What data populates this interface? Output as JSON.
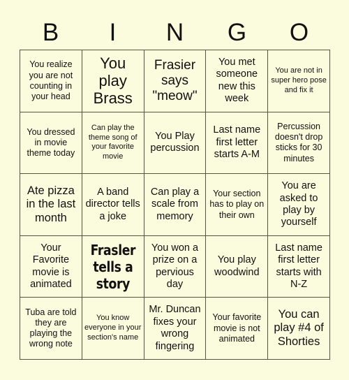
{
  "card": {
    "header_letters": [
      "B",
      "I",
      "N",
      "G",
      "O"
    ],
    "colors": {
      "background": "#FBFBDD",
      "border": "#55553f",
      "text": "#111111"
    },
    "grid_size": "5x5",
    "cells": [
      {
        "text": "You realize you are not counting in your head",
        "size": "s",
        "free": false
      },
      {
        "text": "You play Brass",
        "size": "xxl",
        "free": false
      },
      {
        "text": "Frasier says \"meow\"",
        "size": "xl",
        "free": false
      },
      {
        "text": "You met someone new this week",
        "size": "m",
        "free": false
      },
      {
        "text": "You are not in super hero pose and fix it",
        "size": "xs",
        "free": false
      },
      {
        "text": "You dressed in movie theme today",
        "size": "s",
        "free": false
      },
      {
        "text": "Can play the theme song of your favorite movie",
        "size": "xs",
        "free": false
      },
      {
        "text": "You Play percussion",
        "size": "m",
        "free": false
      },
      {
        "text": "Last name first letter starts A-M",
        "size": "m",
        "free": false
      },
      {
        "text": "Percussion doesn't drop sticks for 30 minutes",
        "size": "s",
        "free": false
      },
      {
        "text": "Ate pizza in the last month",
        "size": "l",
        "free": false
      },
      {
        "text": "A band director tells a joke",
        "size": "m",
        "free": false
      },
      {
        "text": "Can play a scale from memory",
        "size": "m",
        "free": false
      },
      {
        "text": "Your section has to play on their own",
        "size": "s",
        "free": false
      },
      {
        "text": "You are asked to play by yourself",
        "size": "m",
        "free": false
      },
      {
        "text": "Your Favorite movie is animated",
        "size": "m",
        "free": false
      },
      {
        "text": "Frasler tells a story",
        "size": "m",
        "free": true
      },
      {
        "text": "You won a prize on a pervious day",
        "size": "m",
        "free": false
      },
      {
        "text": "You play woodwind",
        "size": "m",
        "free": false
      },
      {
        "text": "Last name first letter starts with N-Z",
        "size": "m",
        "free": false
      },
      {
        "text": "Tuba are told they are playing the wrong note",
        "size": "s",
        "free": false
      },
      {
        "text": "You know everyone in your section's name",
        "size": "xs",
        "free": false
      },
      {
        "text": "Mr. Duncan fixes your wrong fingering",
        "size": "m",
        "free": false
      },
      {
        "text": "Your favorite movie is not animated",
        "size": "s",
        "free": false
      },
      {
        "text": "You can play #4 of Shorties",
        "size": "l",
        "free": false
      }
    ]
  }
}
